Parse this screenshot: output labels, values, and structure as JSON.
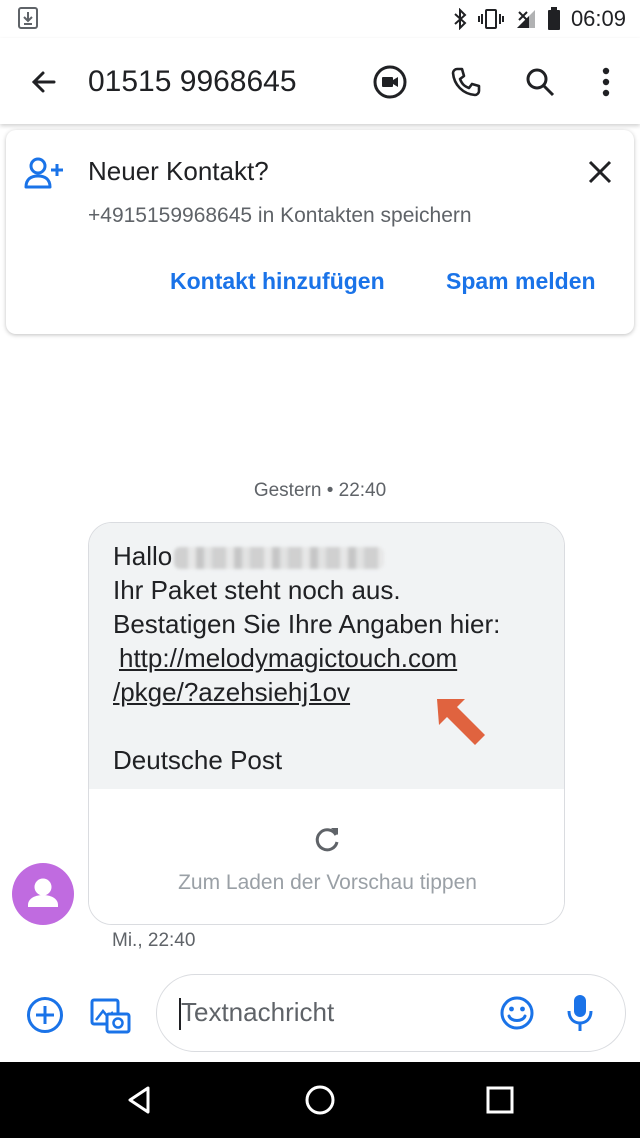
{
  "status_bar": {
    "time": "06:09",
    "icons": [
      "download-icon",
      "bluetooth-icon",
      "vibrate-icon",
      "signal-icon",
      "battery-icon"
    ]
  },
  "app_bar": {
    "title": "01515 9968645",
    "icons": [
      "back-arrow-icon",
      "video-call-icon",
      "phone-icon",
      "search-icon",
      "more-vert-icon"
    ]
  },
  "contact_card": {
    "title": "Neuer Kontakt?",
    "subtitle": "+4915159968645 in Kontakten speichern",
    "add_label": "Kontakt hinzufügen",
    "spam_label": "Spam melden"
  },
  "conversation": {
    "date_separator": "Gestern • 22:40",
    "message": {
      "greeting": "Hallo",
      "line2": "Ihr Paket steht noch aus.",
      "line3": "Bestatigen Sie Ihre Angaben hier:",
      "link_part1": "http://melodymagictouch.com",
      "link_part2": "/pkge/?azehsiehj1ov",
      "signature": "Deutsche Post"
    },
    "preview_hint": "Zum Laden der Vorschau tippen",
    "timestamp": "Mi., 22:40"
  },
  "compose": {
    "placeholder": "Textnachricht"
  },
  "colors": {
    "accent": "#1a73e8",
    "avatar": "#c06be0",
    "arrow": "#e0633f",
    "bubble": "#f1f3f4"
  }
}
